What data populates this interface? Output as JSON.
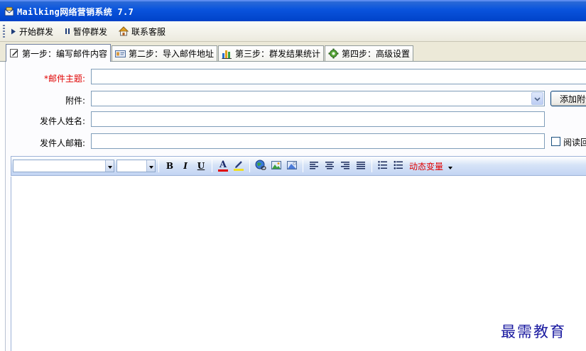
{
  "window": {
    "title": "Mailking网络营销系统 7.7",
    "icon": "app-mail-icon"
  },
  "toolbar": {
    "items": [
      {
        "label": "开始群发",
        "icon": "play-icon"
      },
      {
        "label": "暂停群发",
        "icon": "pause-icon"
      },
      {
        "label": "联系客服",
        "icon": "home-icon"
      }
    ]
  },
  "tabs": [
    {
      "label": "第一步：编写邮件内容",
      "icon": "edit-icon",
      "active": true
    },
    {
      "label": "第二步：导入邮件地址",
      "icon": "card-icon",
      "active": false
    },
    {
      "label": "第三步：群发结果统计",
      "icon": "bar-chart-icon",
      "active": false
    },
    {
      "label": "第四步：高级设置",
      "icon": "gear-icon",
      "active": false
    }
  ],
  "form": {
    "subject_label": "*邮件主题:",
    "subject_value": "",
    "attachment_label": "附件:",
    "attachment_value": "",
    "add_attachment_label": "添加附件",
    "sender_name_label": "发件人姓名:",
    "sender_name_value": "",
    "sender_email_label": "发件人邮箱:",
    "sender_email_value": "",
    "read_receipt_label": "阅读回执",
    "read_receipt_checked": false
  },
  "editor": {
    "font_value": "",
    "size_value": "",
    "bold": "B",
    "italic": "I",
    "underline": "U",
    "text_color": "A",
    "dynamic_var_label": "动态变量",
    "content": ""
  },
  "watermark": "最需教育",
  "colors": {
    "titlebar": "#0a54dd",
    "required_label": "#e00000",
    "watermark": "#1a1aa0"
  }
}
